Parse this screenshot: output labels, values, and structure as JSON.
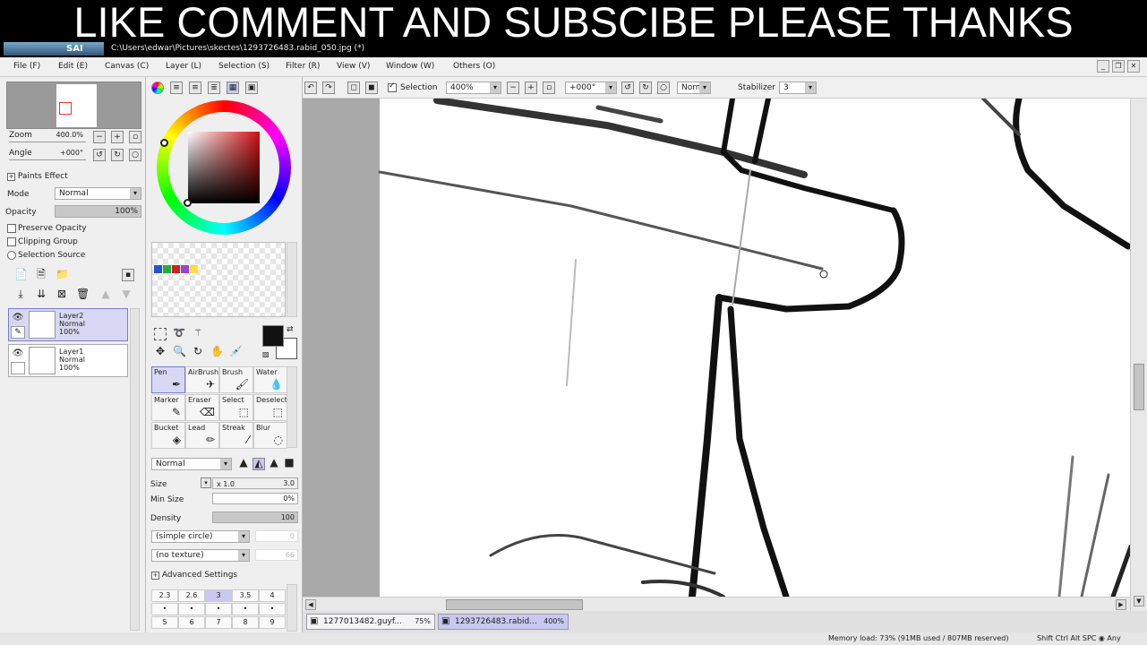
{
  "banner": {
    "text": "LIKE COMMENT AND SUBSCIBE PLEASE THANKS"
  },
  "titlebar": {
    "app_logo": "SAI",
    "file_path": "C:\\Users\\edwar\\Pictures\\skectes\\1293726483.rabid_050.jpg (*)"
  },
  "menu": {
    "items": [
      "File (F)",
      "Edit (E)",
      "Canvas (C)",
      "Layer (L)",
      "Selection (S)",
      "Filter (R)",
      "View (V)",
      "Window (W)",
      "Others (O)"
    ]
  },
  "toolbar": {
    "selection_label": "Selection",
    "zoom_value": "400%",
    "angle_value": "+000°",
    "blend_value": "Normal",
    "stabilizer_label": "Stabilizer",
    "stabilizer_value": "3"
  },
  "navigator": {
    "zoom_label": "Zoom",
    "zoom_value": "400.0%",
    "angle_label": "Angle",
    "angle_value": "+000°"
  },
  "layer_props": {
    "effect_label": "Paints Effect",
    "mode_label": "Mode",
    "mode_value": "Normal",
    "opacity_label": "Opacity",
    "opacity_value": "100%",
    "opacity_fraction": 1.0,
    "preserve_label": "Preserve Opacity",
    "clipping_label": "Clipping Group",
    "selection_source_label": "Selection Source"
  },
  "layers": [
    {
      "name": "Layer2",
      "mode": "Normal",
      "opacity": "100%",
      "selected": true
    },
    {
      "name": "Layer1",
      "mode": "Normal",
      "opacity": "100%",
      "selected": false
    }
  ],
  "colors": {
    "primary": "#111111",
    "secondary": "#ffffff",
    "swatches": [
      "#2255cc",
      "#22aa44",
      "#cc2222",
      "#9944cc",
      "#ffdd44"
    ]
  },
  "tools": [
    {
      "name": "Pen",
      "icon": "✒",
      "selected": true
    },
    {
      "name": "AirBrush",
      "icon": "✈",
      "selected": false
    },
    {
      "name": "Brush",
      "icon": "🖌",
      "selected": false
    },
    {
      "name": "Water",
      "icon": "💧",
      "selected": false
    },
    {
      "name": "Marker",
      "icon": "✎",
      "selected": false
    },
    {
      "name": "Eraser",
      "icon": "⌫",
      "selected": false
    },
    {
      "name": "Select",
      "icon": "⬚",
      "selected": false
    },
    {
      "name": "Deselect",
      "icon": "⬚",
      "selected": false
    },
    {
      "name": "Bucket",
      "icon": "◈",
      "selected": false
    },
    {
      "name": "Lead",
      "icon": "✏",
      "selected": false
    },
    {
      "name": "Streak",
      "icon": "⁄",
      "selected": false
    },
    {
      "name": "Blur",
      "icon": "◌",
      "selected": false
    }
  ],
  "brush": {
    "blend_value": "Normal",
    "size_label": "Size",
    "size_mult": "x 1.0",
    "size_value": "3.0",
    "minsize_label": "Min Size",
    "minsize_value": "0%",
    "density_label": "Density",
    "density_value": "100",
    "shape_value": "(simple circle)",
    "texture_value": "(no texture)",
    "shape_amount": "0",
    "texture_amount": "66",
    "advanced_label": "Advanced Settings",
    "presets": [
      "2.3",
      "2.6",
      "3",
      "3.5",
      "4"
    ],
    "presets2": [
      "5",
      "6",
      "7",
      "8",
      "9"
    ],
    "selected_preset": 2
  },
  "tabs": [
    {
      "name": "1277013482.guyf...",
      "zoom": "75%",
      "selected": false
    },
    {
      "name": "1293726483.rabid...",
      "zoom": "400%",
      "selected": true
    }
  ],
  "status": {
    "memory": "Memory load: 73% (91MB used / 807MB reserved)",
    "keys": "Shift Ctrl Alt SPC ◉ Any"
  }
}
